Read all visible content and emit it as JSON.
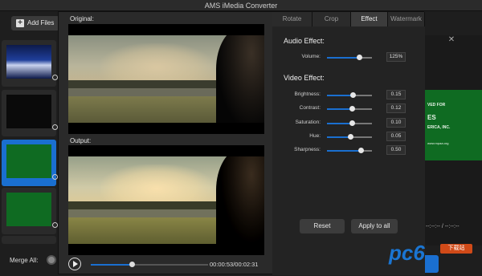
{
  "app": {
    "title": "AMS iMedia Converter"
  },
  "toolbar": {
    "add_files_label": "Add Files"
  },
  "merge": {
    "label": "Merge All:"
  },
  "right_preview": {
    "lines": [
      "VED FOR",
      "ES",
      "ERICA, INC.",
      "www.mpaa.org"
    ],
    "time": "--:--:-- / --:--:--"
  },
  "convert": {
    "label": "D"
  },
  "editor": {
    "original_label": "Original:",
    "output_label": "Output:",
    "time_readout": "00:00:53/00:02:31",
    "progress": 0.35,
    "tabs": [
      {
        "label": "Rotate",
        "active": false
      },
      {
        "label": "Crop",
        "active": false
      },
      {
        "label": "Effect",
        "active": true
      },
      {
        "label": "Watermark",
        "active": false
      }
    ],
    "audio_title": "Audio Effect:",
    "video_title": "Video Effect:",
    "audio": [
      {
        "label": "Volume:",
        "value": "125%",
        "level": 0.72
      }
    ],
    "video": [
      {
        "label": "Brightness:",
        "value": "0.15",
        "level": 0.57
      },
      {
        "label": "Contrast:",
        "value": "0.12",
        "level": 0.56
      },
      {
        "label": "Saturation:",
        "value": "0.10",
        "level": 0.55
      },
      {
        "label": "Hue:",
        "value": "0.05",
        "level": 0.52
      },
      {
        "label": "Sharpness:",
        "value": "0.50",
        "level": 0.75
      }
    ],
    "reset_label": "Reset",
    "apply_label": "Apply to all"
  },
  "watermark_overlay": {
    "logo": "pc6",
    "badge": "下载站"
  },
  "colors": {
    "accent": "#1a6fd0",
    "panel": "#232323",
    "window": "#1e1e1e"
  }
}
